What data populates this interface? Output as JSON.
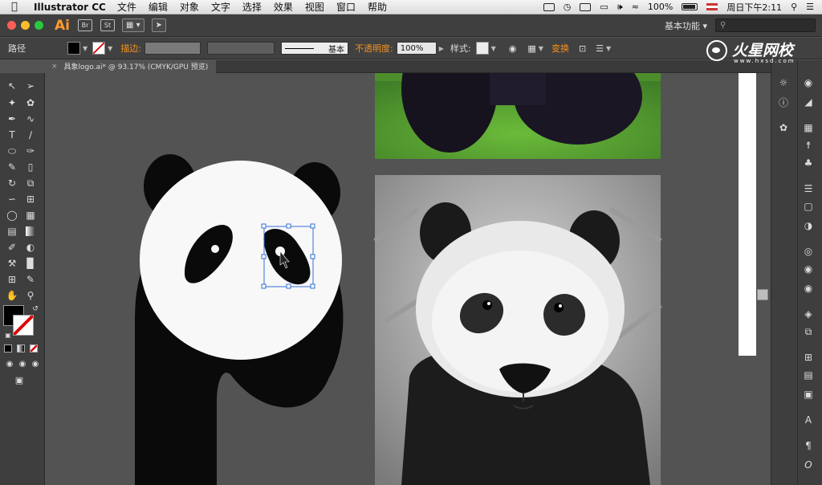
{
  "menubar": {
    "app_name": "Illustrator CC",
    "items": [
      "文件",
      "编辑",
      "对象",
      "文字",
      "选择",
      "效果",
      "视图",
      "窗口",
      "帮助"
    ],
    "battery": "100%",
    "clock": "周日下午2:11"
  },
  "titlebar": {
    "app_logo": "Ai",
    "badge_br": "Br",
    "badge_st": "St",
    "workspace": "基本功能"
  },
  "controlbar": {
    "path_label": "路径",
    "stroke_label": "描边:",
    "stroke_style": "基本",
    "opacity_label": "不透明度:",
    "opacity_value": "100%",
    "style_label": "样式:",
    "transform_label": "变换",
    "fill_color": "#000000"
  },
  "watermark": {
    "title": "火星网校",
    "subtitle": "www.hxsd.com"
  },
  "document": {
    "tab_label": "具象logo.ai* @ 93.17% (CMYK/GPU 预览)",
    "close": "×"
  },
  "colors": {
    "panda_black": "#0a0a0a",
    "panda_white": "#f8f8f8",
    "selection": "#2f6fd6",
    "canvas_bg": "#535353"
  },
  "icons": {
    "toolbar": [
      "selection-tool-icon",
      "direct-selection-tool-icon",
      "magic-wand-icon",
      "lasso-icon",
      "pen-tool-icon",
      "curvature-icon",
      "type-tool-icon",
      "line-tool-icon",
      "ellipse-tool-icon",
      "paintbrush-icon",
      "pencil-icon",
      "eraser-icon",
      "rotate-icon",
      "scale-icon",
      "warp-icon",
      "free-transform-icon",
      "shape-builder-icon",
      "graph-icon",
      "mesh-icon",
      "gradient-icon",
      "eyedropper-icon",
      "blend-icon",
      "symbol-sprayer-icon",
      "column-graph-icon",
      "artboard-icon",
      "slice-icon",
      "hand-icon",
      "zoom-icon"
    ]
  }
}
